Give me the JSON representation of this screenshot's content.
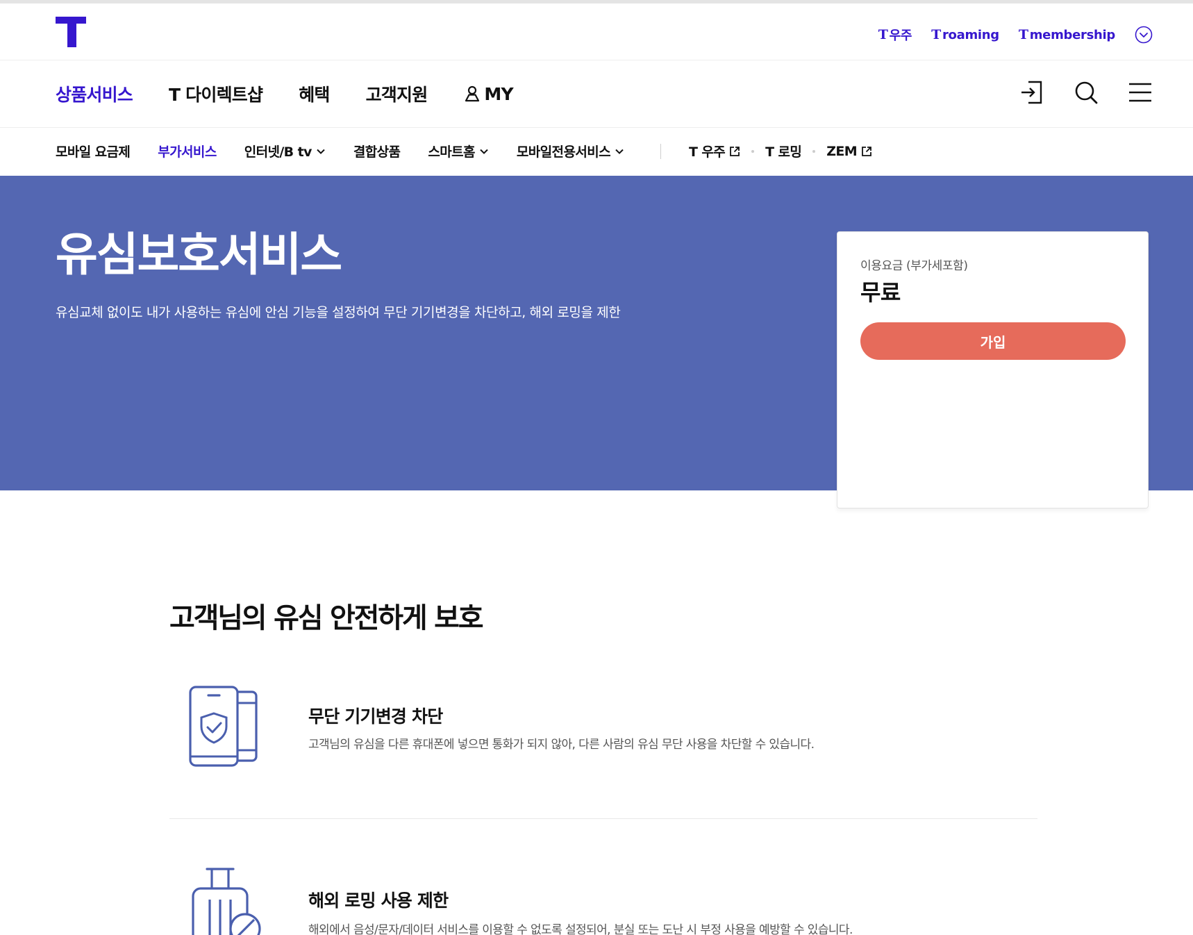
{
  "colors": {
    "brand": "#3617ce",
    "hero_bg": "#5467b2",
    "join_button": "#e66b5b"
  },
  "header": {
    "logo_icon": "t-logo-icon",
    "util_links": [
      {
        "mark": "T",
        "label": "우주"
      },
      {
        "mark": "T",
        "label": "roaming"
      },
      {
        "mark": "T",
        "label": "membership"
      }
    ],
    "util_more_icon": "chevron-circle-down-icon"
  },
  "gnb": {
    "items": [
      {
        "label": "상품서비스"
      },
      {
        "label": "T 다이렉트샵"
      },
      {
        "label": "혜택"
      },
      {
        "label": "고객지원"
      },
      {
        "label": "MY"
      }
    ],
    "icons": [
      "login-icon",
      "search-icon",
      "menu-icon"
    ]
  },
  "subnav": {
    "items": [
      {
        "label": "모바일 요금제"
      },
      {
        "label": "부가서비스"
      },
      {
        "label": "인터넷/B tv"
      },
      {
        "label": "결합상품"
      },
      {
        "label": "스마트홈"
      },
      {
        "label": "모바일전용서비스"
      }
    ],
    "external": [
      {
        "label": "T 우주"
      },
      {
        "label": "T 로밍"
      },
      {
        "label": "ZEM"
      }
    ]
  },
  "hero": {
    "title": "유심보호서비스",
    "description": "유심교체 없이도 내가 사용하는 유심에 안심 기능을 설정하여 무단 기기변경을 차단하고, 해외 로밍을 제한"
  },
  "price_card": {
    "label": "이용요금 (부가세포함)",
    "value": "무료",
    "join_label": "가입"
  },
  "content": {
    "section_title": "고객님의 유심 안전하게 보호",
    "features": [
      {
        "icon": "phone-shield-icon",
        "title": "무단 기기변경 차단",
        "description": "고객님의 유심을 다른 휴대폰에 넣으면 통화가 되지 않아, 다른 사람의 유심 무단 사용을 차단할 수 있습니다."
      },
      {
        "icon": "luggage-block-icon",
        "title": "해외 로밍 사용 제한",
        "description": "해외에서 음성/문자/데이터 서비스를 이용할 수 없도록 설정되어, 분실 또는 도난 시 부정 사용을 예방할 수 있습니다."
      }
    ]
  }
}
